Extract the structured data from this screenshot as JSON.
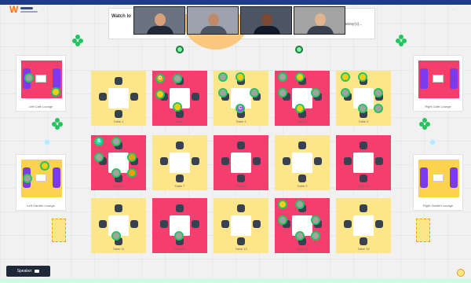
{
  "header": {
    "brand": "W",
    "left_caption": "...",
    "right_caption": "..."
  },
  "stage": {
    "title": "Watch lo",
    "right_note": "...eeaway(s)..."
  },
  "video_feeds": [
    {
      "name": "participant-1",
      "bg": "#6b7280",
      "skin": "#d9a07a",
      "shirt": "#1f2937"
    },
    {
      "name": "participant-2",
      "bg": "#9ca3af",
      "skin": "#c08a68",
      "shirt": "#4b5563"
    },
    {
      "name": "participant-3",
      "bg": "#4b5563",
      "skin": "#7a4a34",
      "shirt": "#111827"
    },
    {
      "name": "participant-4",
      "bg": "#a3a3a3",
      "skin": "#e0b48f",
      "shirt": "#374151"
    }
  ],
  "lounges": [
    {
      "label": "Left Cafe Lounge",
      "color": "pink"
    },
    {
      "label": "Right Cafe Lounge",
      "color": "pink"
    },
    {
      "label": "Left Garden Lounge",
      "color": "yellow"
    },
    {
      "label": "Right Garden Lounge",
      "color": "yellow"
    }
  ],
  "tables": [
    {
      "label": "Table 1",
      "color": "yellow"
    },
    {
      "label": "Table 2",
      "color": "pink"
    },
    {
      "label": "Table 3",
      "color": "yellow"
    },
    {
      "label": "Table 4",
      "color": "pink"
    },
    {
      "label": "Table 5",
      "color": "yellow"
    },
    {
      "label": "Table 6",
      "color": "pink"
    },
    {
      "label": "Table 7",
      "color": "yellow"
    },
    {
      "label": "Table 8",
      "color": "pink"
    },
    {
      "label": "Table 9",
      "color": "yellow"
    },
    {
      "label": "Table 10",
      "color": "pink"
    },
    {
      "label": "Table 11",
      "color": "yellow"
    },
    {
      "label": "Table 12",
      "color": "pink"
    },
    {
      "label": "Table 13",
      "color": "yellow"
    },
    {
      "label": "Table 14",
      "color": "pink"
    },
    {
      "label": "Table 15",
      "color": "yellow"
    }
  ],
  "speaker_button": {
    "label": "Speaker"
  },
  "colors": {
    "pink": "#f43f6e",
    "yellow": "#fde68a",
    "presence": "#22c55e",
    "sofa": "#7c3aed",
    "topbar": "#1e3a8a"
  },
  "icons": [
    "clover-icon",
    "plant-icon",
    "lamp-icon",
    "camera-icon",
    "user-avatar-icon"
  ]
}
